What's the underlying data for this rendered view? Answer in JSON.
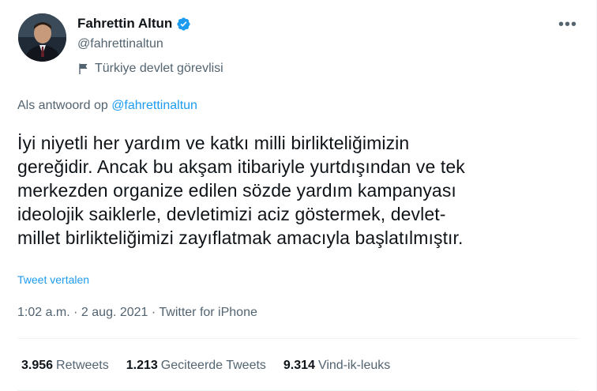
{
  "author": {
    "display_name": "Fahrettin Altun",
    "handle": "@fahrettinaltun",
    "label": "Türkiye devlet görevlisi",
    "verified_icon": "verified-badge-icon",
    "label_icon": "flag-icon"
  },
  "more_icon": "more-horizontal-icon",
  "reply_context": {
    "prefix": "Als antwoord op",
    "mention": "@fahrettinaltun"
  },
  "tweet": {
    "lines": [
      "İyi niyetli her yardım ve katkı milli birlikteliğimizin",
      "gereğidir. Ancak bu akşam itibariyle yurtdışından ve tek",
      "merkezden organize edilen sözde yardım kampanyası",
      "ideolojik saiklerle, devletimizi aciz göstermek, devlet-",
      "millet birlikteliğimizi zayıflatmak amacıyla başlatılmıştır."
    ],
    "translate": "Tweet vertalen"
  },
  "meta": {
    "text": "1:02 a.m. · 2 aug. 2021 · Twitter for iPhone"
  },
  "stats": {
    "retweets_count": "3.956",
    "retweets_label": "Retweets",
    "quotes_count": "1.213",
    "quotes_label": "Geciteerde Tweets",
    "likes_count": "9.314",
    "likes_label": "Vind-ik-leuks"
  },
  "colors": {
    "accent": "#1d9bf0",
    "text": "#0f1419",
    "secondary": "#536471"
  }
}
